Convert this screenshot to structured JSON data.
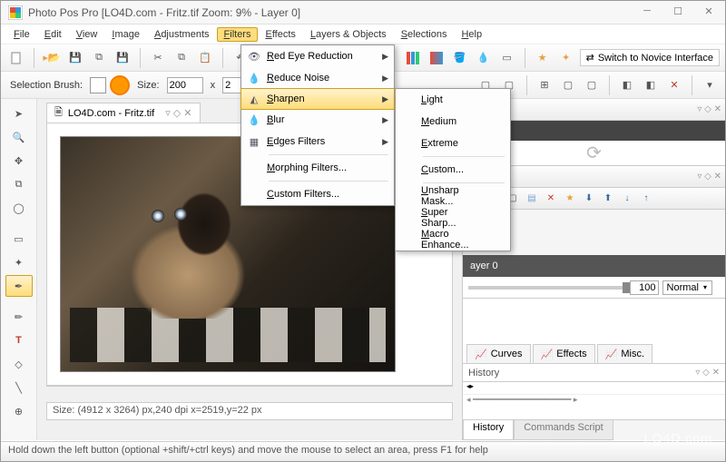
{
  "window": {
    "title": "Photo Pos Pro  [LO4D.com - Fritz.tif Zoom: 9% - Layer 0]"
  },
  "menubar": [
    "File",
    "Edit",
    "View",
    "Image",
    "Adjustments",
    "Filters",
    "Effects",
    "Layers & Objects",
    "Selections",
    "Help"
  ],
  "menubar_active_index": 5,
  "filters_menu": {
    "items": [
      {
        "label": "Red Eye Reduction",
        "icon": "eye-icon",
        "submenu": true
      },
      {
        "label": "Reduce Noise",
        "icon": "drop-icon",
        "submenu": true
      },
      {
        "label": "Sharpen",
        "icon": "triangle-icon",
        "submenu": true,
        "highlight": true
      },
      {
        "label": "Blur",
        "icon": "drop-icon",
        "submenu": true
      },
      {
        "label": "Edges Filters",
        "icon": "grid-icon",
        "submenu": true
      },
      {
        "sep": true
      },
      {
        "label": "Morphing Filters...",
        "icon": "",
        "submenu": false
      },
      {
        "sep": true
      },
      {
        "label": "Custom Filters...",
        "icon": "",
        "submenu": false
      }
    ]
  },
  "sharpen_menu": {
    "items": [
      "Light",
      "Medium",
      "Extreme",
      "__sep__",
      "Custom...",
      "__sep__",
      "Unsharp Mask...",
      "Super Sharp...",
      "Macro Enhance..."
    ]
  },
  "toolbar2": {
    "label_brush": "Selection Brush:",
    "label_size": "Size:",
    "size_w": "200",
    "size_h": "2"
  },
  "switch_label": "Switch to Novice Interface",
  "doc_tab": "LO4D.com - Fritz.tif",
  "canvas_status": "Size: (4912 x 3264) px,240 dpi   x=2519,y=22 px",
  "statusbar": "Hold down the left button (optional +shift/+ctrl keys) and move the mouse to select an area, press F1 for help",
  "right": {
    "layer_name": "ayer 0",
    "opacity": "100",
    "blend": "Normal",
    "tabs": [
      "Curves",
      "Effects",
      "Misc."
    ],
    "history_label": "History",
    "bottom_tabs": [
      "History",
      "Commands Script"
    ]
  },
  "watermark": "LO4D.com"
}
